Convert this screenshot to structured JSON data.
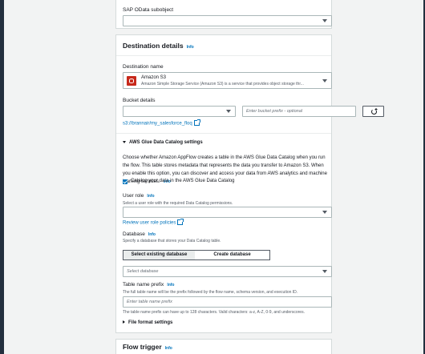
{
  "top_panel": {
    "subobject_label": "SAP OData subobject"
  },
  "destination": {
    "title": "Destination details",
    "info": "Info",
    "dest_name_label": "Destination name",
    "dest_name": "Amazon S3",
    "dest_desc": "Amazon Simple Storage Service (Amazon S3) is a service that provides object storage thr...",
    "bucket_label": "Bucket details",
    "bucket_prefix_placeholder": "Enter bucket prefix - optional",
    "s3_link": "s3://brannair/my_salesforce_floq",
    "glue_section_title": "AWS Glue Data Catalog settings",
    "glue_desc": "Choose whether Amazon AppFlow creates a table in the AWS Glue Data Catalog when you run the flow. This table stores metadata that represents the data you transfer to Amazon S3. When you enable this option, you can discover and access your data from AWS analytics and machine learning services.",
    "glue_checkbox_label": "Catalog your data in the AWS Glue Data Catalog",
    "user_role_label": "User role",
    "user_role_desc": "Select a user role with the required Data Catalog permissions.",
    "review_policies_link": "Review user role policies",
    "database_label": "Database",
    "database_desc": "Specify a database that stores your Data Catalog table.",
    "seg_select_existing": "Select existing database",
    "seg_create": "Create database",
    "select_database_placeholder": "Select database",
    "table_prefix_label": "Table name prefix",
    "table_prefix_desc": "The full table name will be the prefix followed by the flow name, schema version, and execution ID.",
    "table_prefix_placeholder": "Enter table name prefix",
    "table_prefix_hint": "The table name prefix can have up to 128 characters. Valid characters: a-z, A-Z, 0-9, and underscores.",
    "file_format_label": "File format settings"
  },
  "flow_trigger": {
    "title": "Flow trigger",
    "info": "Info"
  },
  "colors": {
    "accent": "#0073bb",
    "checkbox": "#0073bb",
    "s3_icon": "#c7291b"
  }
}
